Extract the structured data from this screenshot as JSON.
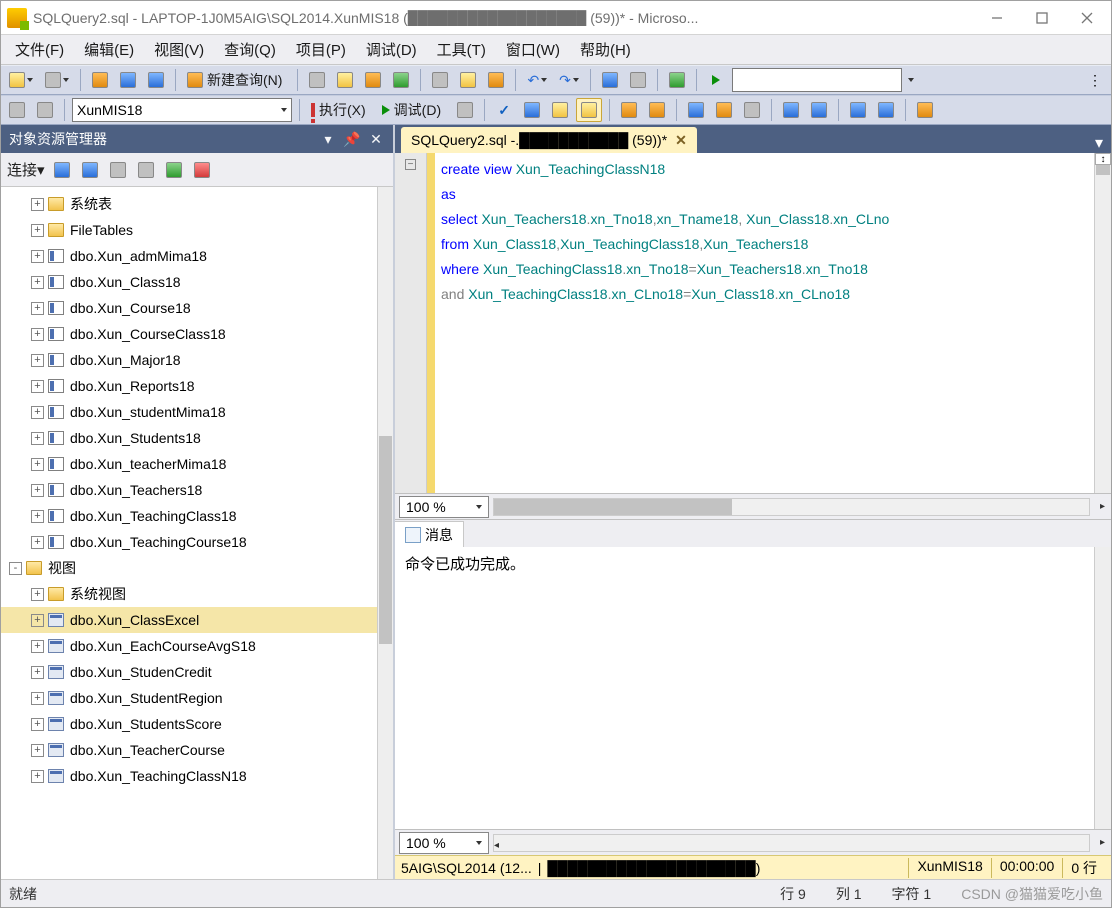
{
  "titlebar": {
    "text": "SQLQuery2.sql - LAPTOP-1J0M5AIG\\SQL2014.XunMIS18 (██████████████████ (59))* - Microso..."
  },
  "menubar": {
    "items": [
      "文件(F)",
      "编辑(E)",
      "视图(V)",
      "查询(Q)",
      "项目(P)",
      "调试(D)",
      "工具(T)",
      "窗口(W)",
      "帮助(H)"
    ]
  },
  "toolbar1": {
    "new_query": "新建查询(N)"
  },
  "toolbar2": {
    "db_selected": "XunMIS18",
    "execute": "执行(X)",
    "debug": "调试(D)"
  },
  "objExplorer": {
    "title": "对象资源管理器",
    "connect_label": "连接▾",
    "items": [
      {
        "depth": 2,
        "exp": "+",
        "icon": "folder",
        "label": "系统表"
      },
      {
        "depth": 2,
        "exp": "+",
        "icon": "folder",
        "label": "FileTables"
      },
      {
        "depth": 2,
        "exp": "+",
        "icon": "table",
        "label": "dbo.Xun_admMima18"
      },
      {
        "depth": 2,
        "exp": "+",
        "icon": "table",
        "label": "dbo.Xun_Class18"
      },
      {
        "depth": 2,
        "exp": "+",
        "icon": "table",
        "label": "dbo.Xun_Course18"
      },
      {
        "depth": 2,
        "exp": "+",
        "icon": "table",
        "label": "dbo.Xun_CourseClass18"
      },
      {
        "depth": 2,
        "exp": "+",
        "icon": "table",
        "label": "dbo.Xun_Major18"
      },
      {
        "depth": 2,
        "exp": "+",
        "icon": "table",
        "label": "dbo.Xun_Reports18"
      },
      {
        "depth": 2,
        "exp": "+",
        "icon": "table",
        "label": "dbo.Xun_studentMima18"
      },
      {
        "depth": 2,
        "exp": "+",
        "icon": "table",
        "label": "dbo.Xun_Students18"
      },
      {
        "depth": 2,
        "exp": "+",
        "icon": "table",
        "label": "dbo.Xun_teacherMima18"
      },
      {
        "depth": 2,
        "exp": "+",
        "icon": "table",
        "label": "dbo.Xun_Teachers18"
      },
      {
        "depth": 2,
        "exp": "+",
        "icon": "table",
        "label": "dbo.Xun_TeachingClass18"
      },
      {
        "depth": 2,
        "exp": "+",
        "icon": "table",
        "label": "dbo.Xun_TeachingCourse18"
      },
      {
        "depth": 1,
        "exp": "-",
        "icon": "folder",
        "label": "视图"
      },
      {
        "depth": 2,
        "exp": "+",
        "icon": "folder",
        "label": "系统视图"
      },
      {
        "depth": 2,
        "exp": "+",
        "icon": "view",
        "label": "dbo.Xun_ClassExcel",
        "selected": true
      },
      {
        "depth": 2,
        "exp": "+",
        "icon": "view",
        "label": "dbo.Xun_EachCourseAvgS18"
      },
      {
        "depth": 2,
        "exp": "+",
        "icon": "view",
        "label": "dbo.Xun_StudenCredit"
      },
      {
        "depth": 2,
        "exp": "+",
        "icon": "view",
        "label": "dbo.Xun_StudentRegion"
      },
      {
        "depth": 2,
        "exp": "+",
        "icon": "view",
        "label": "dbo.Xun_StudentsScore"
      },
      {
        "depth": 2,
        "exp": "+",
        "icon": "view",
        "label": "dbo.Xun_TeacherCourse"
      },
      {
        "depth": 2,
        "exp": "+",
        "icon": "view",
        "label": "dbo.Xun_TeachingClassN18"
      }
    ]
  },
  "editor": {
    "tab_title": "SQLQuery2.sql -.███████████ (59))*",
    "zoom": "100 %",
    "sql_tokens": [
      [
        [
          "kw",
          "create"
        ],
        [
          "sp",
          " "
        ],
        [
          "kw",
          "view"
        ],
        [
          "sp",
          " "
        ],
        [
          "ident",
          "Xun_TeachingClassN18"
        ]
      ],
      [
        [
          "kw",
          "as"
        ]
      ],
      [
        [
          "kw",
          "select"
        ],
        [
          "sp",
          " "
        ],
        [
          "ident",
          "Xun_Teachers18"
        ],
        [
          "gray",
          "."
        ],
        [
          "ident",
          "xn_Tno18"
        ],
        [
          "gray",
          ","
        ],
        [
          "ident",
          "xn_Tname18"
        ],
        [
          "gray",
          ", "
        ],
        [
          "ident",
          "Xun_Class18"
        ],
        [
          "gray",
          "."
        ],
        [
          "ident",
          "xn_CLno"
        ]
      ],
      [
        [
          "kw",
          "from"
        ],
        [
          "sp",
          " "
        ],
        [
          "ident",
          "Xun_Class18"
        ],
        [
          "gray",
          ","
        ],
        [
          "ident",
          "Xun_TeachingClass18"
        ],
        [
          "gray",
          ","
        ],
        [
          "ident",
          "Xun_Teachers18"
        ]
      ],
      [
        [
          "kw",
          "where"
        ],
        [
          "sp",
          " "
        ],
        [
          "ident",
          "Xun_TeachingClass18"
        ],
        [
          "gray",
          "."
        ],
        [
          "ident",
          "xn_Tno18"
        ],
        [
          "gray",
          "="
        ],
        [
          "ident",
          "Xun_Teachers18"
        ],
        [
          "gray",
          "."
        ],
        [
          "ident",
          "xn_Tno18"
        ]
      ],
      [
        [
          "gray",
          "and"
        ],
        [
          "sp",
          " "
        ],
        [
          "ident",
          "Xun_TeachingClass18"
        ],
        [
          "gray",
          "."
        ],
        [
          "ident",
          "xn_CLno18"
        ],
        [
          "gray",
          "="
        ],
        [
          "ident",
          "Xun_Class18"
        ],
        [
          "gray",
          "."
        ],
        [
          "ident",
          "xn_CLno18"
        ]
      ]
    ]
  },
  "messages": {
    "tab": "消息",
    "text": "命令已成功完成。",
    "zoom": "100 %"
  },
  "statusYellow": {
    "server": "5AIG\\SQL2014 (12...",
    "user": "█████████████████████)",
    "db": "XunMIS18",
    "time": "00:00:00",
    "rows": "0 行"
  },
  "statusbar": {
    "ready": "就绪",
    "line": "行 9",
    "col": "列 1",
    "char": "字符 1",
    "watermark": "CSDN @猫猫爱吃小鱼"
  }
}
